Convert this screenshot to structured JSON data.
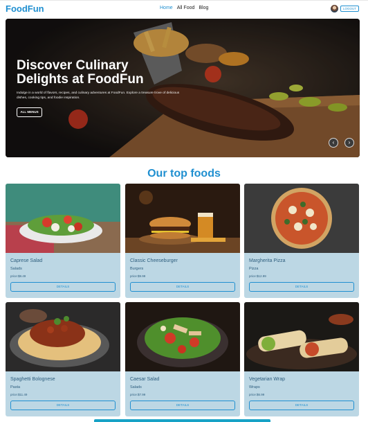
{
  "navbar": {
    "brand": "FoodFun",
    "links": [
      {
        "label": "Home",
        "active": true
      },
      {
        "label": "All Food",
        "active": false
      },
      {
        "label": "Blog",
        "active": false
      }
    ],
    "logout_label": "LOGOUT"
  },
  "hero": {
    "title": "Discover Culinary Delights at FoodFun",
    "text": "Indulge in a world of flavors, recipes, and culinary adventures at FoodFun. Explore a treasure trove of delicious dishes, cooking tips, and foodie inspiration.",
    "button_label": "ALL MENUS",
    "prev_icon": "chevron-left-icon",
    "next_icon": "chevron-right-icon"
  },
  "section": {
    "title": "Our top foods"
  },
  "foods": [
    {
      "name": "Caprese Salad",
      "category": "Salads",
      "price": "price:$8.49",
      "button": "DETAILS"
    },
    {
      "name": "Classic Cheeseburger",
      "category": "Burgers",
      "price": "price:$9.99",
      "button": "DETAILS"
    },
    {
      "name": "Margherita Pizza",
      "category": "Pizza",
      "price": "price:$12.99",
      "button": "DETAILS"
    },
    {
      "name": "Spaghetti Bolognese",
      "category": "Pasta",
      "price": "price:$11.49",
      "button": "DETAILS"
    },
    {
      "name": "Caesar Salad",
      "category": "Salads",
      "price": "price:$7.99",
      "button": "DETAILS"
    },
    {
      "name": "Vegetarian Wrap",
      "category": "Wraps",
      "price": "price:$6.99",
      "button": "DETAILS"
    }
  ],
  "colors": {
    "accent": "#1f8fd0",
    "card_bg": "#bcd7e4",
    "card_text": "#2d5d7d"
  }
}
